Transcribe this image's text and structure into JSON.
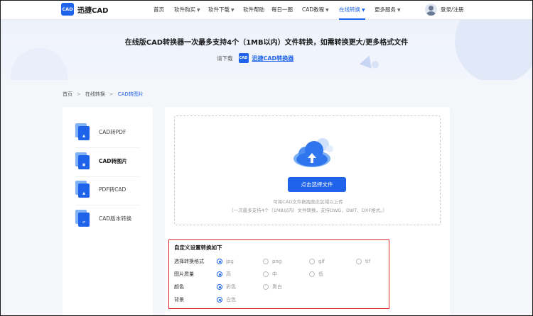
{
  "header": {
    "logo_badge": "CAD",
    "logo_text": "迅捷CAD",
    "nav": [
      {
        "label": "首页",
        "has_dropdown": false,
        "active": false
      },
      {
        "label": "软件购买",
        "has_dropdown": true,
        "active": false
      },
      {
        "label": "软件下载",
        "has_dropdown": true,
        "active": false
      },
      {
        "label": "软件帮助",
        "has_dropdown": false,
        "active": false
      },
      {
        "label": "每日一图",
        "has_dropdown": false,
        "active": false
      },
      {
        "label": "CAD教程",
        "has_dropdown": true,
        "active": false
      },
      {
        "label": "在线转换",
        "has_dropdown": true,
        "active": true
      },
      {
        "label": "更多服务",
        "has_dropdown": true,
        "active": false
      }
    ],
    "login_label": "登录/注册"
  },
  "banner": {
    "title": "在线版CAD转换器一次最多支持4个（1MB以内）文件转换，如需转换更大/更多格式文件",
    "download_label": "请下载",
    "download_badge": "CAD",
    "download_link": "迅捷CAD转换器"
  },
  "breadcrumb": {
    "items": [
      "首页",
      "在线转换"
    ],
    "current": "CAD转图片"
  },
  "sidebar": {
    "items": [
      {
        "label": "CAD转PDF",
        "active": false
      },
      {
        "label": "CAD转图片",
        "active": true
      },
      {
        "label": "PDF转CAD",
        "active": false
      },
      {
        "label": "CAD版本转换",
        "active": false
      }
    ]
  },
  "upload": {
    "button_label": "点击选择文件",
    "hint_line1": "可将CAD文件拖拽至此区域以上传",
    "hint_line2": "（一次最多支持4个（1MB以内）文件转换，支持DWG、DWT、DXF格式。）"
  },
  "settings": {
    "title": "自定义设置转换如下",
    "rows": [
      {
        "label": "选择转换格式",
        "options": [
          {
            "label": "jpg",
            "checked": true
          },
          {
            "label": "png",
            "checked": false
          },
          {
            "label": "gif",
            "checked": false
          },
          {
            "label": "tif",
            "checked": false
          }
        ]
      },
      {
        "label": "图片质量",
        "options": [
          {
            "label": "高",
            "checked": true
          },
          {
            "label": "中",
            "checked": false
          },
          {
            "label": "低",
            "checked": false
          }
        ]
      },
      {
        "label": "颜色",
        "options": [
          {
            "label": "彩色",
            "checked": true
          },
          {
            "label": "黑白",
            "checked": false
          }
        ]
      },
      {
        "label": "背景",
        "options": [
          {
            "label": "白色",
            "checked": true
          }
        ]
      }
    ]
  },
  "colors": {
    "accent": "#1e63e9",
    "highlight_border": "#d9252b"
  }
}
